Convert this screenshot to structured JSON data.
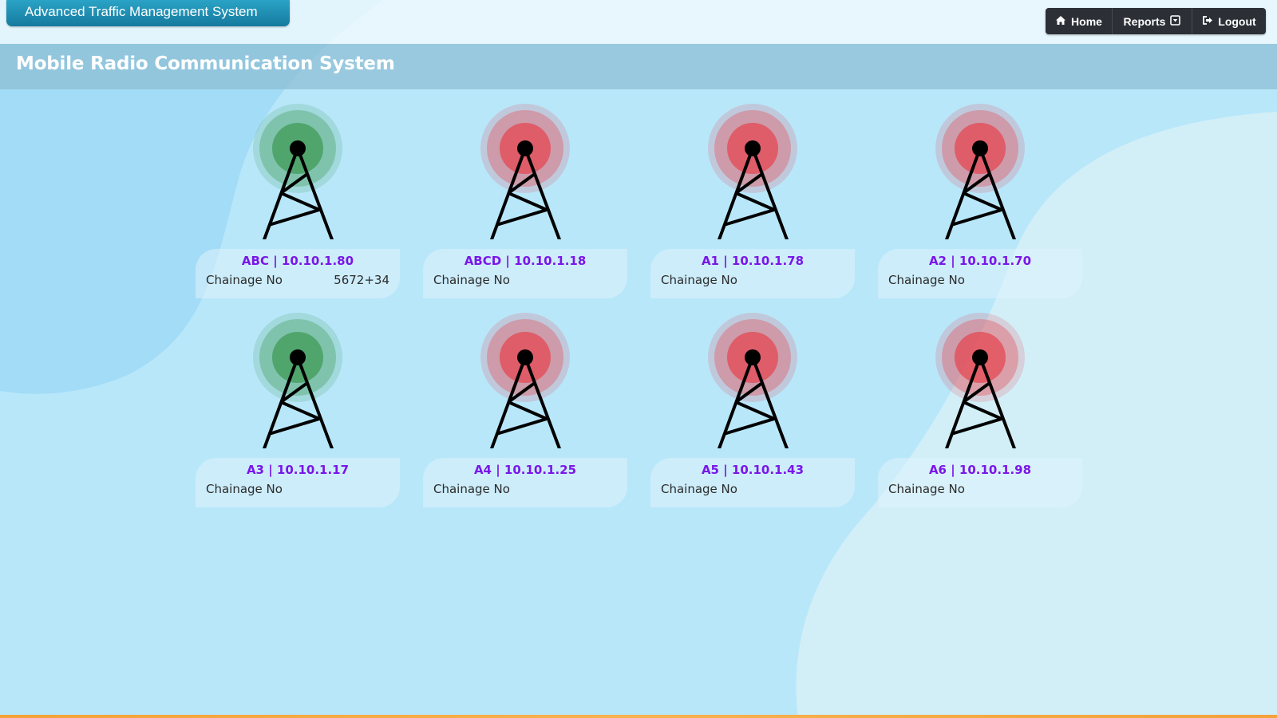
{
  "header": {
    "app_title": "Advanced Traffic Management System",
    "nav": {
      "home_label": "Home",
      "reports_label": "Reports",
      "logout_label": "Logout"
    },
    "icons": {
      "home": "home-icon",
      "reports": "caret-square-down-icon",
      "logout": "sign-out-icon"
    }
  },
  "page": {
    "title": "Mobile Radio Communication System"
  },
  "status_colors": {
    "online": "#3f9a55",
    "offline": "#e4454f"
  },
  "devices": [
    {
      "title": "ABC | 10.10.1.80",
      "chainage_label": "Chainage No",
      "chainage_value": "5672+34",
      "status": "online"
    },
    {
      "title": "ABCD | 10.10.1.18",
      "chainage_label": "Chainage No",
      "chainage_value": "",
      "status": "offline"
    },
    {
      "title": "A1 | 10.10.1.78",
      "chainage_label": "Chainage No",
      "chainage_value": "",
      "status": "offline"
    },
    {
      "title": "A2 | 10.10.1.70",
      "chainage_label": "Chainage No",
      "chainage_value": "",
      "status": "offline"
    },
    {
      "title": "A3 | 10.10.1.17",
      "chainage_label": "Chainage No",
      "chainage_value": "",
      "status": "online"
    },
    {
      "title": "A4 | 10.10.1.25",
      "chainage_label": "Chainage No",
      "chainage_value": "",
      "status": "offline"
    },
    {
      "title": "A5 | 10.10.1.43",
      "chainage_label": "Chainage No",
      "chainage_value": "",
      "status": "offline"
    },
    {
      "title": "A6 | 10.10.1.98",
      "chainage_label": "Chainage No",
      "chainage_value": "",
      "status": "offline"
    }
  ]
}
